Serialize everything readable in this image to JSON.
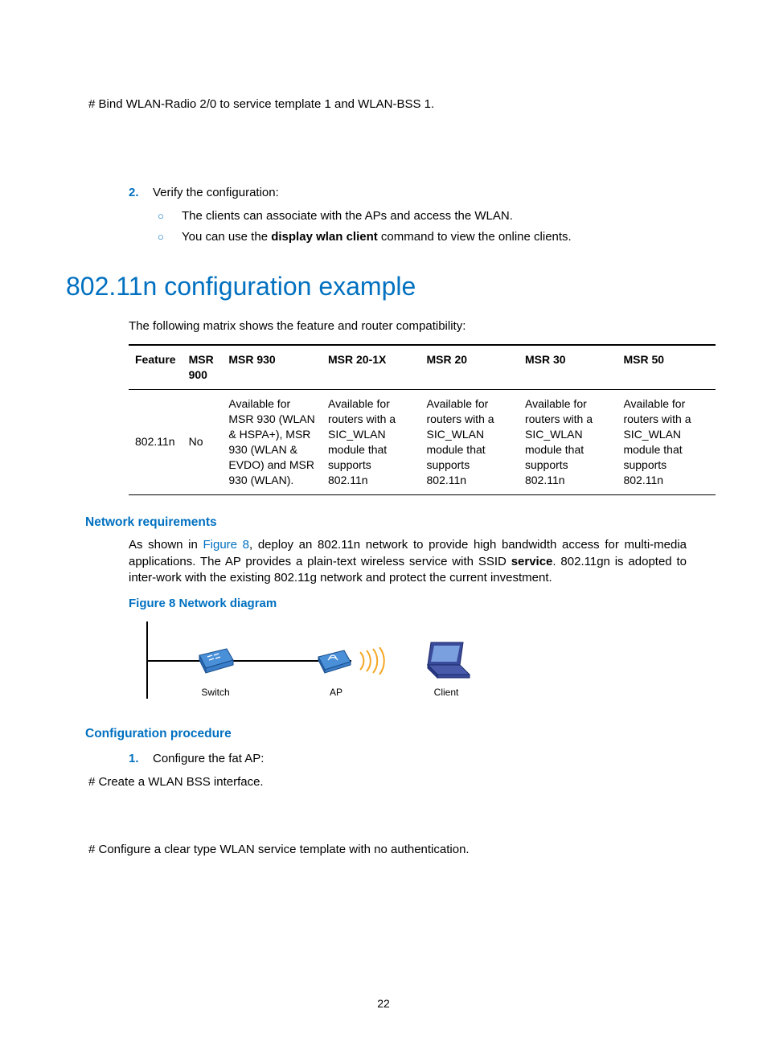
{
  "top_note": "# Bind WLAN-Radio 2/0 to service template 1 and WLAN-BSS 1.",
  "step2": {
    "num": "2.",
    "text": "Verify the configuration:",
    "sub1": "The clients can associate with the APs and access the WLAN.",
    "sub2_a": "You can use the ",
    "sub2_b": "display wlan client",
    "sub2_c": " command to view the online clients."
  },
  "h1": "802.11n configuration example",
  "matrix_intro": "The following matrix shows the feature and router compatibility:",
  "table": {
    "headers": [
      "Feature",
      "MSR 900",
      "MSR 930",
      "MSR 20-1X",
      "MSR 20",
      "MSR 30",
      "MSR 50"
    ],
    "row": [
      "802.11n",
      "No",
      "Available for MSR 930 (WLAN & HSPA+), MSR 930 (WLAN & EVDO) and MSR 930 (WLAN).",
      "Available for routers with a SIC_WLAN module that supports 802.11n",
      "Available for routers with a SIC_WLAN module that supports 802.11n",
      "Available for routers with a SIC_WLAN module that supports 802.11n",
      "Available for routers with a SIC_WLAN module that supports 802.11n"
    ]
  },
  "netreq_h": "Network requirements",
  "netreq_p_a": "As shown in ",
  "netreq_p_link": "Figure 8",
  "netreq_p_b": ", deploy an 802.11n network to provide high bandwidth access for multi-media applications. The AP provides a plain-text wireless service with SSID ",
  "netreq_p_bold": "service",
  "netreq_p_c": ". 802.11gn is adopted to inter-work with the existing 802.11g network and protect the current investment.",
  "fig_caption": "Figure 8 Network diagram",
  "diagram": {
    "switch": "Switch",
    "ap": "AP",
    "client": "Client"
  },
  "cfgproc_h": "Configuration procedure",
  "step1": {
    "num": "1.",
    "text": "Configure the fat AP:"
  },
  "note_a": "# Create a WLAN BSS interface.",
  "note_b": "# Configure a clear type WLAN service template with no authentication.",
  "page_num": "22"
}
